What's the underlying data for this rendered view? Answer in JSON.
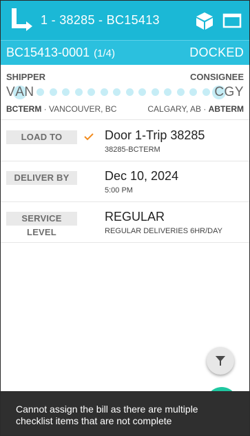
{
  "header": {
    "trip_title": "1 - 38285 - BC15413",
    "logo_icon": "app-logo-icon",
    "package_icon": "package-icon",
    "window_icon": "window-icon",
    "color": "#1bb8d6"
  },
  "subheader": {
    "bill_id": "BC15413-0001",
    "bill_count": "(1/4)",
    "status": "DOCKED",
    "color": "#2bc0de"
  },
  "route": {
    "shipper_label": "SHIPPER",
    "consignee_label": "CONSIGNEE",
    "origin_code_a": "V",
    "origin_code_b": "AN",
    "dest_code_a": "CG",
    "dest_code_b": "Y",
    "origin_terminal": "BCTERM",
    "origin_city": "VANCOUVER, BC",
    "dest_city": "CALGARY, AB",
    "dest_terminal": "ABTERM",
    "separator": "·"
  },
  "details": [
    {
      "label": "LOAD TO",
      "main": "Door 1-Trip 38285",
      "sub": "38285-BCTERM",
      "checked": true
    },
    {
      "label": "DELIVER BY",
      "main": "Dec 10, 2024",
      "sub": "5:00 PM",
      "checked": false
    },
    {
      "label": "SERVICE LEVEL",
      "main": "REGULAR",
      "sub": "REGULAR DELIVERIES 6HR/DAY",
      "checked": false
    }
  ],
  "fab": {
    "icon": "filter-funnel-icon"
  },
  "toast": {
    "message": "Cannot assign the bill as there are multiple checklist items that are not complete"
  }
}
